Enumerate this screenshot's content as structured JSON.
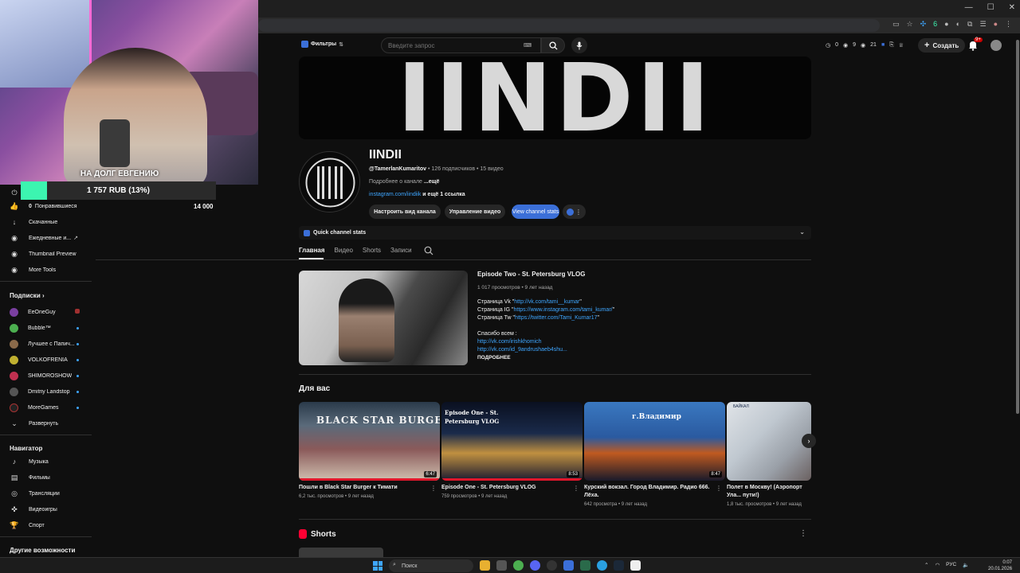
{
  "overlay": {
    "debt_title": "НА ДОЛГ ЕВГЕНИЮ",
    "donation_text": "1 757 RUB (13%)",
    "donation_percent": 13,
    "donation_goal": "14 000"
  },
  "sidebar": {
    "top_items": [
      {
        "label": "Понравившиеся",
        "count": "0"
      },
      {
        "label": "Скачанные"
      },
      {
        "label": "Ежедневные и..."
      },
      {
        "label": "Thumbnail Preview"
      },
      {
        "label": "More Tools"
      }
    ],
    "subscriptions_header": "Подписки",
    "subscriptions": [
      {
        "label": "EeOneGuy",
        "color": "#7a3fa0"
      },
      {
        "label": "Bubble™",
        "color": "#4caf50"
      },
      {
        "label": "Лучшее с Папич...",
        "color": "#8a6a4a"
      },
      {
        "label": "VOLKOFRENIA",
        "color": "#c0b030"
      },
      {
        "label": "SHIMOROSHOW",
        "color": "#c03050"
      },
      {
        "label": "Dmitriy Landstop",
        "color": "#555555"
      },
      {
        "label": "MoreGames",
        "color": "#222222"
      },
      {
        "label": "Развернуть"
      }
    ],
    "navigator_header": "Навигатор",
    "navigator": [
      {
        "label": "Музыка"
      },
      {
        "label": "Фильмы"
      },
      {
        "label": "Трансляции"
      },
      {
        "label": "Видеоигры"
      },
      {
        "label": "Спорт"
      }
    ],
    "more_header": "Другие возможности"
  },
  "header": {
    "filters_label": "Фильтры",
    "search_placeholder": "Введите запрос",
    "counter_a": "0",
    "counter_b": "9",
    "counter_c": "21",
    "create_label": "Создать",
    "notif_badge": "9+"
  },
  "banner": {
    "text": "IINDII"
  },
  "channel": {
    "name": "IINDII",
    "handle": "@TamerlanKumaritov",
    "meta": " • 126 подписчиков • 15 видео",
    "about_prefix": "Подробнее о канале ",
    "about_more": "...ещё",
    "link_text": "instagram.com/iindiik",
    "link_suffix": " и ещё 1 ссылка",
    "btn_customize": "Настроить вид канала",
    "btn_manage": "Управление видео",
    "btn_stats": "View channel stats"
  },
  "quick_stats": {
    "label": "Quick channel stats"
  },
  "tabs": [
    {
      "label": "Главная",
      "active": true
    },
    {
      "label": "Видео"
    },
    {
      "label": "Shorts"
    },
    {
      "label": "Записи"
    }
  ],
  "featured": {
    "title": "Episode Two - St. Petersburg VLOG",
    "meta": "1 017 просмотров • 9 лет назад",
    "line_vk_prefix": "Страница Vk \"",
    "line_vk_link": "http://vk.com/tami__kumar",
    "line_ig_prefix": "Страница IG \"",
    "line_ig_link": "https://www.instagram.com/tami_kumar/",
    "line_tw_prefix": "Страница Tw \"",
    "line_tw_link": "https://twitter.com/Tami_Kumar17",
    "thanks": "Спасибо всем :",
    "thanks_link1": "http://vk.com/irishkhomich",
    "thanks_link2": "http://vk.com/id_9andrushaeb4shu...",
    "more": "ПОДРОБНЕЕ"
  },
  "for_you": {
    "title": "Для вас",
    "cards": [
      {
        "title": "Пошли в Black Star Burger к Тимати",
        "meta": "6,2 тыс. просмотров • 9 лет назад",
        "duration": "6:47",
        "watched": true,
        "thumb_text": "BLACK STAR BURGER"
      },
      {
        "title": "Episode One - St. Petersburg VLOG",
        "meta": "759 просмотров • 9 лет назад",
        "duration": "8:53",
        "watched": true,
        "thumb_text": "Episode One - St. Petersburg VLOG"
      },
      {
        "title": "Курский вокзал. Город Владимир. Радио 666. Лёха.",
        "meta": "642 просмотра • 9 лет назад",
        "duration": "8:47",
        "watched": false,
        "thumb_text": "г.Владимир"
      },
      {
        "title": "Полет в Москву! (Аэропорт Ула... пути!)",
        "meta": "1,8 тыс. просмотров • 9 лет назад",
        "duration": "",
        "watched": false,
        "thumb_text": "БАЙКАЛ"
      }
    ]
  },
  "shorts": {
    "title": "Shorts"
  },
  "taskbar": {
    "search_label": "Поиск",
    "lang": "РУС",
    "time": "0:07",
    "date": "20.01.2026"
  }
}
